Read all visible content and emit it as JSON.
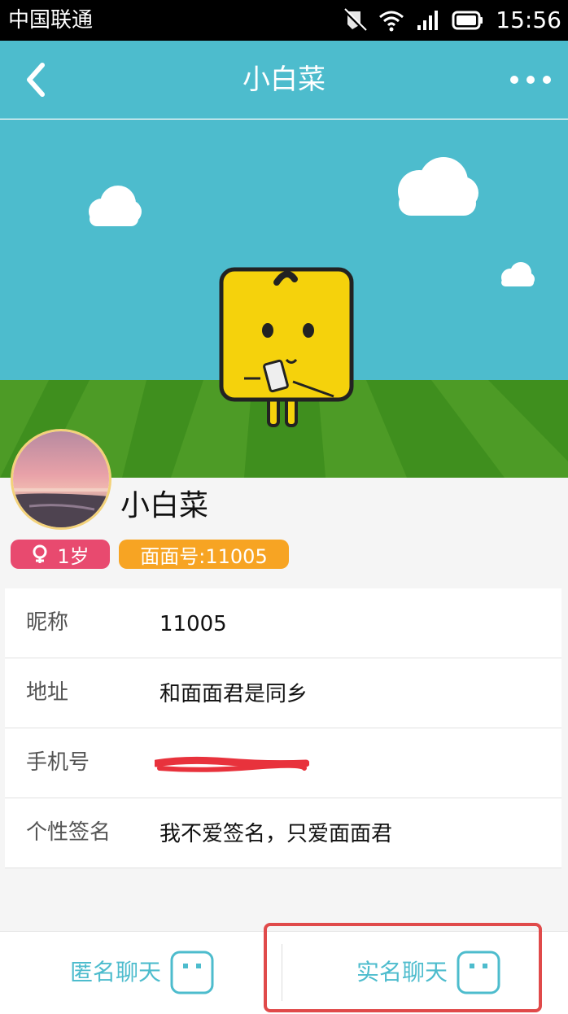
{
  "status_bar": {
    "carrier": "中国联通",
    "time": "15:56",
    "icons": [
      "mute-icon",
      "wifi-icon",
      "signal-icon",
      "battery-icon"
    ]
  },
  "nav": {
    "title": "小白菜",
    "back_icon": "chevron-left-icon",
    "more_icon": "more-dots-icon"
  },
  "profile": {
    "name": "小白菜",
    "age_badge": "1岁",
    "id_badge": "面面号:11005"
  },
  "info": [
    {
      "label": "昵称",
      "value": "11005"
    },
    {
      "label": "地址",
      "value": "和面面君是同乡"
    },
    {
      "label": "手机号",
      "value": ""
    },
    {
      "label": "个性签名",
      "value": "我不爱签名，只爱面面君"
    }
  ],
  "bottom": {
    "anonymous_chat": "匿名聊天",
    "realname_chat": "实名聊天"
  },
  "colors": {
    "nav_bg": "#4dbccd",
    "age_badge": "#e84a6f",
    "id_badge": "#f7a423",
    "highlight": "#e04a4a"
  }
}
